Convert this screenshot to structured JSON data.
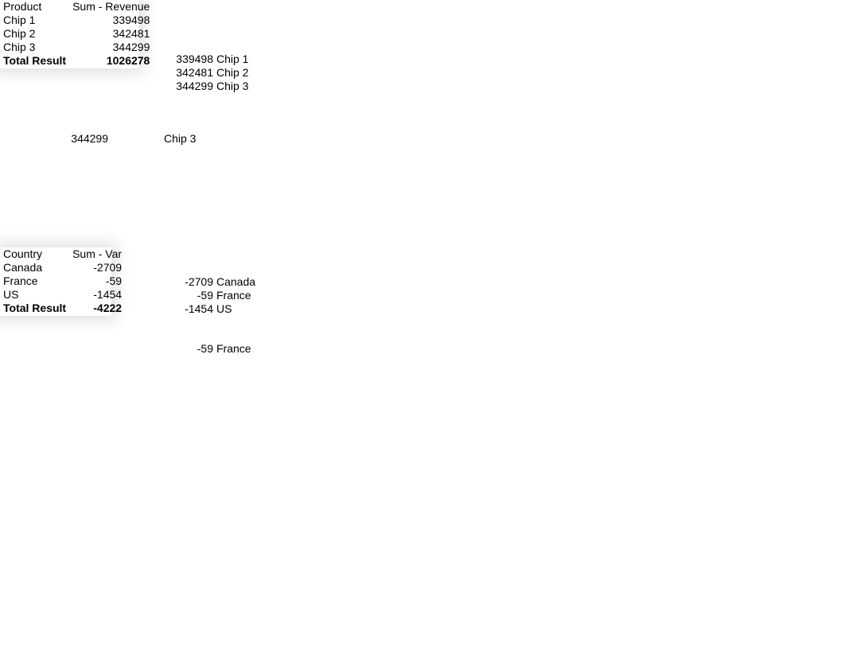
{
  "pivot1": {
    "header_row_label": "Product",
    "header_value_label": "Sum - Revenue",
    "rows": [
      {
        "label": "Chip 1",
        "value": "339498"
      },
      {
        "label": "Chip 2",
        "value": "342481"
      },
      {
        "label": "Chip 3",
        "value": "344299"
      }
    ],
    "total_label": "Total Result",
    "total_value": "1026278"
  },
  "side1": {
    "rows": [
      {
        "value": "339498",
        "label": "Chip 1"
      },
      {
        "value": "342481",
        "label": "Chip 2"
      },
      {
        "value": "344299",
        "label": "Chip 3"
      }
    ]
  },
  "detached1": {
    "value": "344299",
    "label": "Chip 3"
  },
  "pivot2": {
    "header_row_label": "Country",
    "header_value_label": "Sum - Var",
    "rows": [
      {
        "label": "Canada",
        "value": "-2709"
      },
      {
        "label": "France",
        "value": "-59"
      },
      {
        "label": "US",
        "value": "-1454"
      }
    ],
    "total_label": "Total Result",
    "total_value": "-4222"
  },
  "side2": {
    "rows": [
      {
        "value": "-2709",
        "label": "Canada"
      },
      {
        "value": "-59",
        "label": "France"
      },
      {
        "value": "-1454",
        "label": "US"
      }
    ]
  },
  "detached2": {
    "value": "-59",
    "label": "France"
  },
  "chart_data": [
    {
      "type": "table",
      "title": "Sum - Revenue by Product",
      "categories": [
        "Chip 1",
        "Chip 2",
        "Chip 3"
      ],
      "values": [
        339498,
        342481,
        344299
      ],
      "total": 1026278
    },
    {
      "type": "table",
      "title": "Sum - Var by Country",
      "categories": [
        "Canada",
        "France",
        "US"
      ],
      "values": [
        -2709,
        -59,
        -1454
      ],
      "total": -4222
    }
  ]
}
